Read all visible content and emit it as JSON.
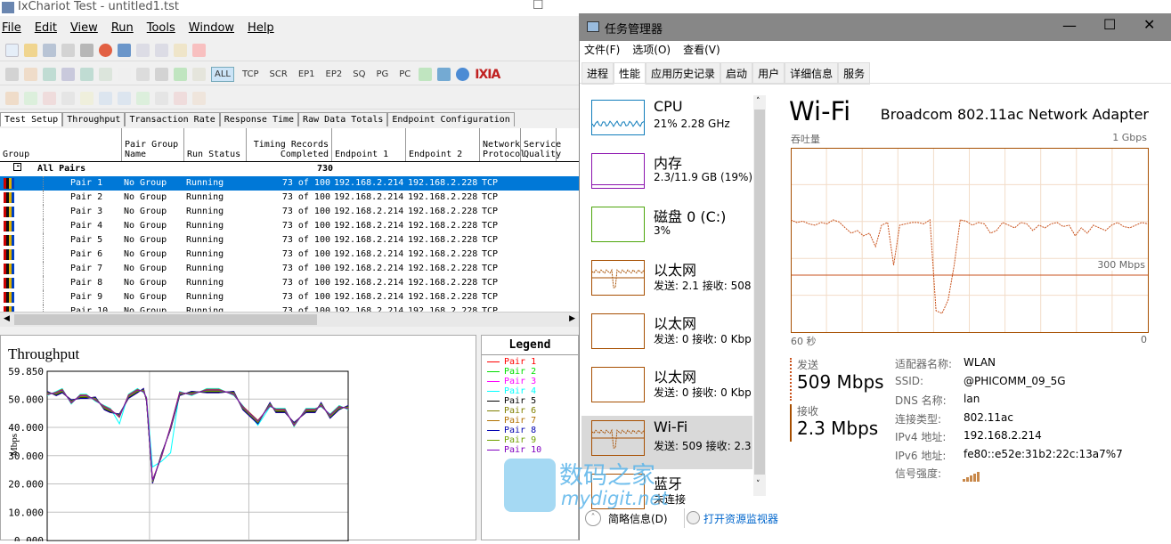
{
  "ixchariot": {
    "title": "IxChariot Test - untitled1.tst",
    "menu": [
      "File",
      "Edit",
      "View",
      "Run",
      "Tools",
      "Window",
      "Help"
    ],
    "filter_buttons": [
      "ALL",
      "TCP",
      "SCR",
      "EP1",
      "EP2",
      "SQ",
      "PG",
      "PC"
    ],
    "brand": "IXIA",
    "tabs": [
      "Test Setup",
      "Throughput",
      "Transaction Rate",
      "Response Time",
      "Raw Data Totals",
      "Endpoint Configuration"
    ],
    "columns": [
      "Group",
      "Pair Group Name",
      "Run Status",
      "Timing Records Completed",
      "Endpoint 1",
      "Endpoint 2",
      "Network Protocol",
      "Service Quality"
    ],
    "all_pairs": {
      "label": "All Pairs",
      "total": "730"
    },
    "rows": [
      {
        "pair": "Pair 1",
        "group": "No Group",
        "status": "Running",
        "records": "73 of 100",
        "ep1": "192.168.2.214",
        "ep2": "192.168.2.228",
        "proto": "TCP"
      },
      {
        "pair": "Pair 2",
        "group": "No Group",
        "status": "Running",
        "records": "73 of 100",
        "ep1": "192.168.2.214",
        "ep2": "192.168.2.228",
        "proto": "TCP"
      },
      {
        "pair": "Pair 3",
        "group": "No Group",
        "status": "Running",
        "records": "73 of 100",
        "ep1": "192.168.2.214",
        "ep2": "192.168.2.228",
        "proto": "TCP"
      },
      {
        "pair": "Pair 4",
        "group": "No Group",
        "status": "Running",
        "records": "73 of 100",
        "ep1": "192.168.2.214",
        "ep2": "192.168.2.228",
        "proto": "TCP"
      },
      {
        "pair": "Pair 5",
        "group": "No Group",
        "status": "Running",
        "records": "73 of 100",
        "ep1": "192.168.2.214",
        "ep2": "192.168.2.228",
        "proto": "TCP"
      },
      {
        "pair": "Pair 6",
        "group": "No Group",
        "status": "Running",
        "records": "73 of 100",
        "ep1": "192.168.2.214",
        "ep2": "192.168.2.228",
        "proto": "TCP"
      },
      {
        "pair": "Pair 7",
        "group": "No Group",
        "status": "Running",
        "records": "73 of 100",
        "ep1": "192.168.2.214",
        "ep2": "192.168.2.228",
        "proto": "TCP"
      },
      {
        "pair": "Pair 8",
        "group": "No Group",
        "status": "Running",
        "records": "73 of 100",
        "ep1": "192.168.2.214",
        "ep2": "192.168.2.228",
        "proto": "TCP"
      },
      {
        "pair": "Pair 9",
        "group": "No Group",
        "status": "Running",
        "records": "73 of 100",
        "ep1": "192.168.2.214",
        "ep2": "192.168.2.228",
        "proto": "TCP"
      },
      {
        "pair": "Pair 10",
        "group": "No Group",
        "status": "Running",
        "records": "73 of 100",
        "ep1": "192.168.2.214",
        "ep2": "192.168.2.228",
        "proto": "TCP"
      }
    ],
    "legend_title": "Legend"
  },
  "chart_data": {
    "type": "line",
    "title": "Throughput",
    "ylabel": "Mbps",
    "xlabel": "",
    "ylim": [
      0,
      59.85
    ],
    "yticks": [
      "59.850",
      "50.000",
      "40.000",
      "30.000",
      "20.000",
      "10.000",
      "0.000"
    ],
    "x": [
      0,
      3,
      5,
      8,
      11,
      13,
      16,
      19,
      21,
      24,
      27,
      30,
      32,
      33,
      35,
      38,
      41,
      44,
      48,
      53,
      57,
      62,
      65,
      70,
      74,
      76,
      79,
      82,
      86,
      89,
      91,
      94,
      97,
      100
    ],
    "base": [
      52,
      52,
      53,
      49,
      51,
      51,
      50,
      47,
      46,
      44,
      51,
      53,
      53,
      50,
      21,
      30,
      40,
      52,
      52,
      53,
      53,
      52,
      47,
      42,
      48,
      46,
      46,
      41,
      46,
      46,
      48,
      44,
      47,
      47
    ],
    "series": [
      {
        "name": "Pair 1",
        "color": "#ff0000"
      },
      {
        "name": "Pair 2",
        "color": "#00e000"
      },
      {
        "name": "Pair 3",
        "color": "#ff00ff"
      },
      {
        "name": "Pair 4",
        "color": "#00ffff"
      },
      {
        "name": "Pair 5",
        "color": "#000000"
      },
      {
        "name": "Pair 6",
        "color": "#808000"
      },
      {
        "name": "Pair 7",
        "color": "#b07000"
      },
      {
        "name": "Pair 8",
        "color": "#0000b0"
      },
      {
        "name": "Pair 9",
        "color": "#70a000"
      },
      {
        "name": "Pair 10",
        "color": "#8000c0"
      }
    ]
  },
  "taskmgr": {
    "title": "任务管理器",
    "menu": [
      "文件(F)",
      "选项(O)",
      "查看(V)"
    ],
    "tabs": [
      "进程",
      "性能",
      "应用历史记录",
      "启动",
      "用户",
      "详细信息",
      "服务"
    ],
    "items": [
      {
        "name": "CPU",
        "sub": "21% 2.28 GHz",
        "color": "#117dbb"
      },
      {
        "name": "内存",
        "sub": "2.3/11.9 GB (19%)",
        "color": "#8b12ae"
      },
      {
        "name": "磁盘 0 (C:)",
        "sub": "3%",
        "color": "#4da60c"
      },
      {
        "name": "以太网",
        "sub": "发送: 2.1  接收: 508",
        "color": "#a74f01"
      },
      {
        "name": "以太网",
        "sub": "发送: 0  接收: 0 Kbps",
        "color": "#a74f01"
      },
      {
        "name": "以太网",
        "sub": "发送: 0  接收: 0 Kbps",
        "color": "#a74f01"
      },
      {
        "name": "Wi-Fi",
        "sub": "发送: 509  接收: 2.3",
        "color": "#a74f01"
      },
      {
        "name": "蓝牙",
        "sub": "未连接",
        "color": "#a74f01"
      }
    ],
    "heading": "Wi-Fi",
    "adapter": "Broadcom 802.11ac Network Adapter",
    "graph_label": "吞吐量",
    "graph_max": "1 Gbps",
    "graph_mid": "300 Mbps",
    "graph_time": "60 秒",
    "graph_zero": "0",
    "send_label": "发送",
    "send_value": "509 Mbps",
    "recv_label": "接收",
    "recv_value": "2.3 Mbps",
    "details": [
      {
        "k": "适配器名称:",
        "v": "WLAN"
      },
      {
        "k": "SSID:",
        "v": "@PHICOMM_09_5G"
      },
      {
        "k": "DNS 名称:",
        "v": "lan"
      },
      {
        "k": "连接类型:",
        "v": "802.11ac"
      },
      {
        "k": "IPv4 地址:",
        "v": "192.168.2.214"
      },
      {
        "k": "IPv6 地址:",
        "v": "fe80::e52e:31b2:22c:13a7%7"
      },
      {
        "k": "信号强度:",
        "v": ""
      }
    ],
    "send_series_mbps": [
      520,
      510,
      515,
      505,
      500,
      510,
      505,
      520,
      512,
      490,
      470,
      480,
      460,
      470,
      420,
      500,
      510,
      350,
      500,
      505,
      510,
      510,
      505,
      520,
      180,
      170,
      220,
      350,
      520,
      515,
      500,
      510,
      505,
      470,
      480,
      510,
      500,
      490,
      510,
      505,
      480,
      500,
      490,
      505,
      510,
      495,
      500,
      460,
      490,
      470,
      500,
      490,
      480,
      500,
      510,
      495,
      490,
      500,
      510,
      505
    ],
    "fewer_details": "简略信息(D)",
    "open_monitor": "打开资源监视器"
  },
  "watermark": {
    "text": "数码之家",
    "url": "mydigit.net"
  }
}
